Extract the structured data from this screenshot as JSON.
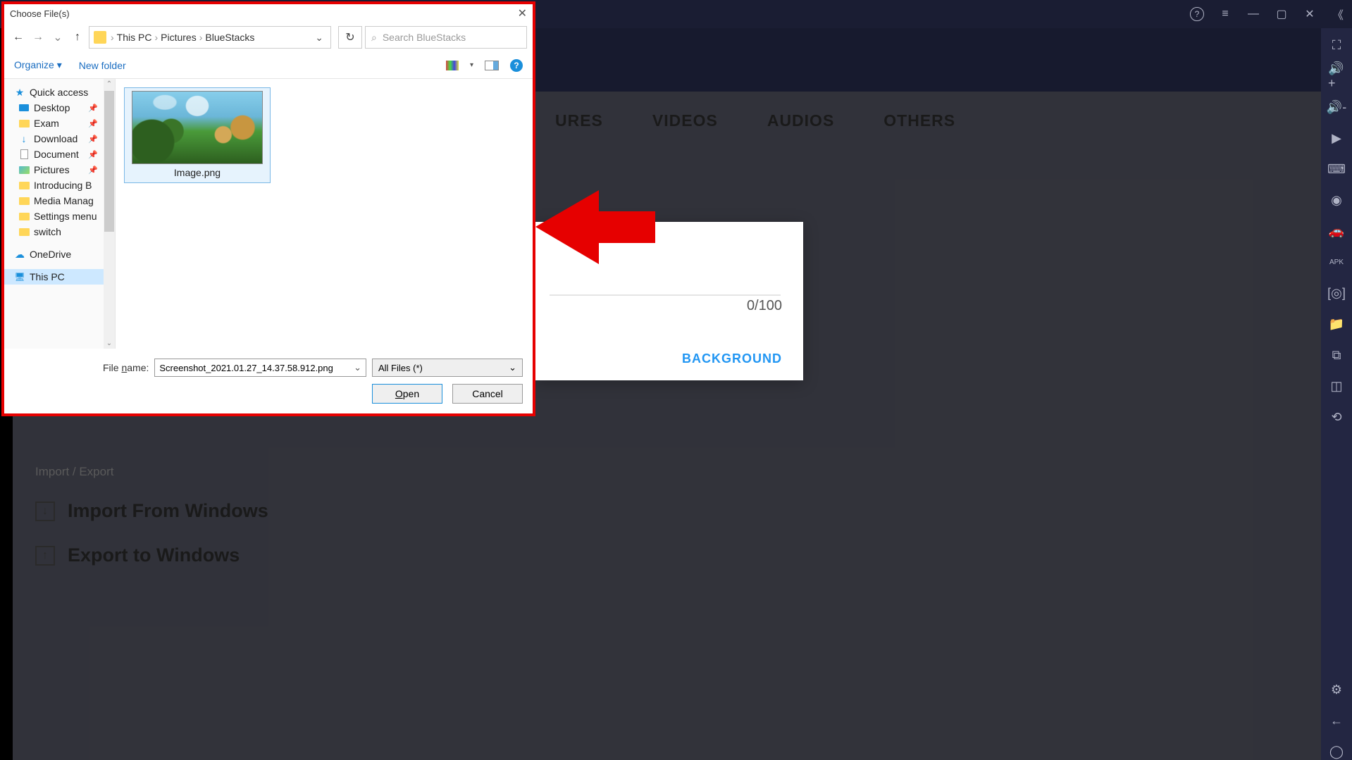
{
  "bsTitlebar": {
    "help": "?",
    "menu": "≡",
    "min": "—",
    "max": "▢",
    "close": "✕",
    "collapse": "《"
  },
  "sidebar": {
    "icons": [
      "⛶",
      "🔊+",
      "🔊-",
      "▶",
      "⌨",
      "◉",
      "🚗",
      "APK",
      "[◎]",
      "📁",
      "⧉",
      "◫",
      "⟲"
    ],
    "bottom": [
      "⚙",
      "←",
      "◯"
    ]
  },
  "tabs": {
    "t1": "URES",
    "t2": "VIDEOS",
    "t3": "AUDIOS",
    "t4": "OTHERS"
  },
  "card": {
    "count": "0/100",
    "button": "BACKGROUND"
  },
  "importSection": {
    "header": "Import / Export",
    "import": "Import From Windows",
    "export": "Export to Windows",
    "iconImport": "↓",
    "iconExport": "↑"
  },
  "dialog": {
    "title": "Choose File(s)",
    "close": "✕",
    "nav": {
      "back": "←",
      "fwd": "→",
      "dropdown": "⌄",
      "up": "↑",
      "refresh": "↻"
    },
    "breadcrumb": {
      "root": "This PC",
      "p1": "Pictures",
      "p2": "BlueStacks",
      "sep": "›",
      "dd": "⌄"
    },
    "search": {
      "icon": "⌕",
      "placeholder": "Search BlueStacks"
    },
    "toolbar": {
      "organize": "Organize ▾",
      "newFolder": "New folder",
      "viewDd": "▾"
    },
    "tree": {
      "quick": "Quick access",
      "desktop": "Desktop",
      "exam": "Exam",
      "download": "Download",
      "document": "Document",
      "pictures": "Pictures",
      "intro": "Introducing B",
      "media": "Media Manag",
      "settings": "Settings menu",
      "switch": "switch",
      "onedrive": "OneDrive",
      "thispc": "This PC",
      "scrollUp": "⌃",
      "scrollDown": "⌄"
    },
    "file": {
      "name": "Image.png"
    },
    "footer": {
      "fnLabel1": "File ",
      "fnLabelU": "n",
      "fnLabel2": "ame:",
      "fileName": "Screenshot_2021.01.27_14.37.58.912.png",
      "filter": "All Files (*)",
      "open1": "O",
      "openU": "p",
      "open2": "en",
      "cancel": "Cancel",
      "dd": "⌄"
    }
  }
}
